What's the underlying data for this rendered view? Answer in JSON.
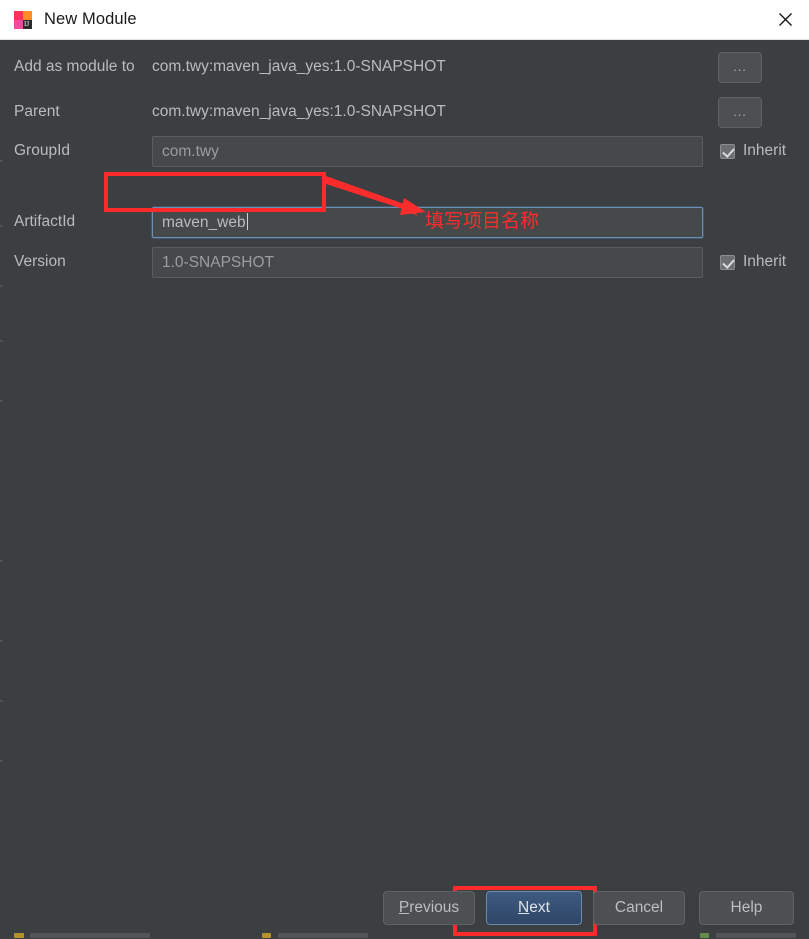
{
  "window": {
    "title": "New Module",
    "icon": "intellij-idea-icon",
    "close_icon": "close-icon",
    "background_color": "#3c3f41",
    "titlebar_color": "#ffffff"
  },
  "form": {
    "rows": [
      {
        "label": "Add as module to",
        "value": "com.twy:maven_java_yes:1.0-SNAPSHOT",
        "type": "plain",
        "chooser": "...",
        "inherit": null
      },
      {
        "label": "Parent",
        "value": "com.twy:maven_java_yes:1.0-SNAPSHOT",
        "type": "plain",
        "chooser": "...",
        "inherit": null
      },
      {
        "label": "GroupId",
        "value": "com.twy",
        "type": "field",
        "chooser": null,
        "inherit": "Inherit"
      },
      {
        "label": "ArtifactId",
        "value": "maven_web",
        "type": "field-focused",
        "chooser": null,
        "inherit": null
      },
      {
        "label": "Version",
        "value": "1.0-SNAPSHOT",
        "type": "field",
        "chooser": null,
        "inherit": "Inherit"
      }
    ]
  },
  "annotations": {
    "color": "#fc2b2b",
    "note_text": "填写项目名称",
    "highlight_artifact_field": true,
    "highlight_next_button": true
  },
  "footer": {
    "buttons": [
      {
        "name": "previous",
        "label": "Previous",
        "mnemonic": "P",
        "primary": false
      },
      {
        "name": "next",
        "label": "Next",
        "mnemonic": "N",
        "primary": true
      },
      {
        "name": "cancel",
        "label": "Cancel",
        "mnemonic": "",
        "primary": false
      },
      {
        "name": "help",
        "label": "Help",
        "mnemonic": "",
        "primary": false
      }
    ]
  }
}
